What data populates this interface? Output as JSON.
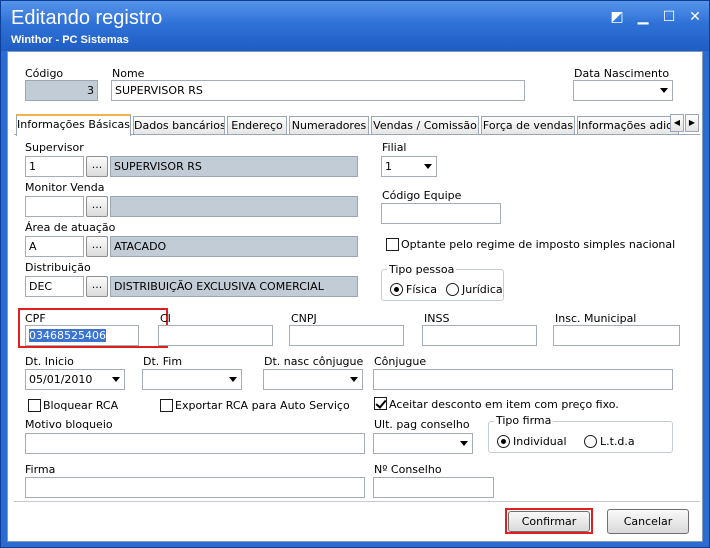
{
  "window": {
    "title": "Editando registro",
    "subtitle": "Winthor - PC Sistemas",
    "controls": [
      "◩",
      "▁",
      "☐",
      "✕"
    ]
  },
  "header": {
    "codigo_label": "Código",
    "codigo_value": "3",
    "nome_label": "Nome",
    "nome_value": "SUPERVISOR RS",
    "data_nasc_label": "Data Nascimento",
    "data_nasc_value": ""
  },
  "tabs": [
    {
      "label": "Informações Básicas",
      "active": true
    },
    {
      "label": "Dados bancários"
    },
    {
      "label": "Endereço"
    },
    {
      "label": "Numeradores"
    },
    {
      "label": "Vendas  / Comissão"
    },
    {
      "label": "Força de vendas"
    },
    {
      "label": "Informações adicio"
    }
  ],
  "tab_scroll": {
    "left": "◀",
    "right": "▶"
  },
  "form": {
    "supervisor": {
      "label": "Supervisor",
      "code": "1",
      "button": "...",
      "name": "SUPERVISOR RS"
    },
    "monitor": {
      "label": "Monitor Venda",
      "code": "",
      "button": "...",
      "name": ""
    },
    "area": {
      "label": "Área de atuação",
      "code": "A",
      "button": "...",
      "name": "ATACADO"
    },
    "distribuicao": {
      "label": "Distribuição",
      "code": "DEC",
      "button": "...",
      "name": "DISTRIBUIÇÃO EXCLUSIVA COMERCIAL"
    },
    "filial": {
      "label": "Filial",
      "value": "1"
    },
    "codigo_equipe": {
      "label": "Código Equipe",
      "value": ""
    },
    "optante": {
      "label": "Optante pelo regime de imposto simples nacional",
      "checked": false
    },
    "tipo_pessoa": {
      "label": "Tipo pessoa",
      "fisica": "Física",
      "juridica": "Jurídica",
      "selected": "fisica"
    },
    "cpf": {
      "label": "CPF",
      "value": "03468525406"
    },
    "ci": {
      "label": "CI",
      "value": ""
    },
    "cnpj": {
      "label": "CNPJ",
      "value": ""
    },
    "inss": {
      "label": "INSS",
      "value": ""
    },
    "insc_municipal": {
      "label": "Insc. Municipal",
      "value": ""
    },
    "dt_inicio": {
      "label": "Dt. Inicio",
      "value": "05/01/2010"
    },
    "dt_fim": {
      "label": "Dt. Fim",
      "value": ""
    },
    "dt_nasc_conjuge": {
      "label": "Dt. nasc cônjugue",
      "value": ""
    },
    "conjuge": {
      "label": "Cônjugue",
      "value": ""
    },
    "bloquear_rca": {
      "label": "Bloquear RCA",
      "checked": false
    },
    "exportar_rca": {
      "label": "Exportar RCA para Auto Serviço",
      "checked": false
    },
    "aceitar_desconto": {
      "label": "Aceitar desconto em item com preço fixo.",
      "checked": true
    },
    "motivo_bloqueio": {
      "label": "Motivo bloqueio",
      "value": ""
    },
    "ult_pag_conselho": {
      "label": "Ult. pag conselho",
      "value": ""
    },
    "tipo_firma": {
      "label": "Tipo firma",
      "individual": "Individual",
      "ltda": "L.t.d.a",
      "selected": "individual"
    },
    "firma": {
      "label": "Firma",
      "value": ""
    },
    "n_conselho": {
      "label": "Nº Conselho",
      "value": ""
    }
  },
  "footer": {
    "confirm_label": "Confirmar",
    "cancel_label": "Cancelar"
  },
  "colors": {
    "titlebar": "#2f72d7",
    "highlight": "#e01f1f",
    "disabled_field": "#c2ccd6",
    "selection": "#3b73d3"
  }
}
